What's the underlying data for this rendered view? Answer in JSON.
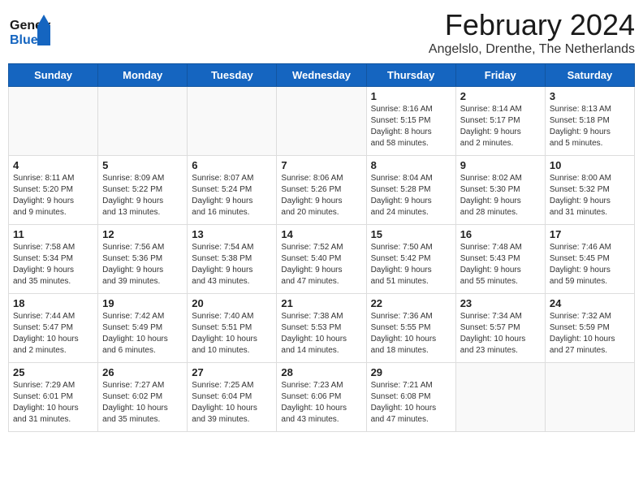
{
  "header": {
    "logo_line1": "General",
    "logo_line2": "Blue",
    "title": "February 2024",
    "subtitle": "Angelslo, Drenthe, The Netherlands"
  },
  "days_of_week": [
    "Sunday",
    "Monday",
    "Tuesday",
    "Wednesday",
    "Thursday",
    "Friday",
    "Saturday"
  ],
  "weeks": [
    [
      {
        "day": "",
        "info": ""
      },
      {
        "day": "",
        "info": ""
      },
      {
        "day": "",
        "info": ""
      },
      {
        "day": "",
        "info": ""
      },
      {
        "day": "1",
        "info": "Sunrise: 8:16 AM\nSunset: 5:15 PM\nDaylight: 8 hours\nand 58 minutes."
      },
      {
        "day": "2",
        "info": "Sunrise: 8:14 AM\nSunset: 5:17 PM\nDaylight: 9 hours\nand 2 minutes."
      },
      {
        "day": "3",
        "info": "Sunrise: 8:13 AM\nSunset: 5:18 PM\nDaylight: 9 hours\nand 5 minutes."
      }
    ],
    [
      {
        "day": "4",
        "info": "Sunrise: 8:11 AM\nSunset: 5:20 PM\nDaylight: 9 hours\nand 9 minutes."
      },
      {
        "day": "5",
        "info": "Sunrise: 8:09 AM\nSunset: 5:22 PM\nDaylight: 9 hours\nand 13 minutes."
      },
      {
        "day": "6",
        "info": "Sunrise: 8:07 AM\nSunset: 5:24 PM\nDaylight: 9 hours\nand 16 minutes."
      },
      {
        "day": "7",
        "info": "Sunrise: 8:06 AM\nSunset: 5:26 PM\nDaylight: 9 hours\nand 20 minutes."
      },
      {
        "day": "8",
        "info": "Sunrise: 8:04 AM\nSunset: 5:28 PM\nDaylight: 9 hours\nand 24 minutes."
      },
      {
        "day": "9",
        "info": "Sunrise: 8:02 AM\nSunset: 5:30 PM\nDaylight: 9 hours\nand 28 minutes."
      },
      {
        "day": "10",
        "info": "Sunrise: 8:00 AM\nSunset: 5:32 PM\nDaylight: 9 hours\nand 31 minutes."
      }
    ],
    [
      {
        "day": "11",
        "info": "Sunrise: 7:58 AM\nSunset: 5:34 PM\nDaylight: 9 hours\nand 35 minutes."
      },
      {
        "day": "12",
        "info": "Sunrise: 7:56 AM\nSunset: 5:36 PM\nDaylight: 9 hours\nand 39 minutes."
      },
      {
        "day": "13",
        "info": "Sunrise: 7:54 AM\nSunset: 5:38 PM\nDaylight: 9 hours\nand 43 minutes."
      },
      {
        "day": "14",
        "info": "Sunrise: 7:52 AM\nSunset: 5:40 PM\nDaylight: 9 hours\nand 47 minutes."
      },
      {
        "day": "15",
        "info": "Sunrise: 7:50 AM\nSunset: 5:42 PM\nDaylight: 9 hours\nand 51 minutes."
      },
      {
        "day": "16",
        "info": "Sunrise: 7:48 AM\nSunset: 5:43 PM\nDaylight: 9 hours\nand 55 minutes."
      },
      {
        "day": "17",
        "info": "Sunrise: 7:46 AM\nSunset: 5:45 PM\nDaylight: 9 hours\nand 59 minutes."
      }
    ],
    [
      {
        "day": "18",
        "info": "Sunrise: 7:44 AM\nSunset: 5:47 PM\nDaylight: 10 hours\nand 2 minutes."
      },
      {
        "day": "19",
        "info": "Sunrise: 7:42 AM\nSunset: 5:49 PM\nDaylight: 10 hours\nand 6 minutes."
      },
      {
        "day": "20",
        "info": "Sunrise: 7:40 AM\nSunset: 5:51 PM\nDaylight: 10 hours\nand 10 minutes."
      },
      {
        "day": "21",
        "info": "Sunrise: 7:38 AM\nSunset: 5:53 PM\nDaylight: 10 hours\nand 14 minutes."
      },
      {
        "day": "22",
        "info": "Sunrise: 7:36 AM\nSunset: 5:55 PM\nDaylight: 10 hours\nand 18 minutes."
      },
      {
        "day": "23",
        "info": "Sunrise: 7:34 AM\nSunset: 5:57 PM\nDaylight: 10 hours\nand 23 minutes."
      },
      {
        "day": "24",
        "info": "Sunrise: 7:32 AM\nSunset: 5:59 PM\nDaylight: 10 hours\nand 27 minutes."
      }
    ],
    [
      {
        "day": "25",
        "info": "Sunrise: 7:29 AM\nSunset: 6:01 PM\nDaylight: 10 hours\nand 31 minutes."
      },
      {
        "day": "26",
        "info": "Sunrise: 7:27 AM\nSunset: 6:02 PM\nDaylight: 10 hours\nand 35 minutes."
      },
      {
        "day": "27",
        "info": "Sunrise: 7:25 AM\nSunset: 6:04 PM\nDaylight: 10 hours\nand 39 minutes."
      },
      {
        "day": "28",
        "info": "Sunrise: 7:23 AM\nSunset: 6:06 PM\nDaylight: 10 hours\nand 43 minutes."
      },
      {
        "day": "29",
        "info": "Sunrise: 7:21 AM\nSunset: 6:08 PM\nDaylight: 10 hours\nand 47 minutes."
      },
      {
        "day": "",
        "info": ""
      },
      {
        "day": "",
        "info": ""
      }
    ]
  ]
}
